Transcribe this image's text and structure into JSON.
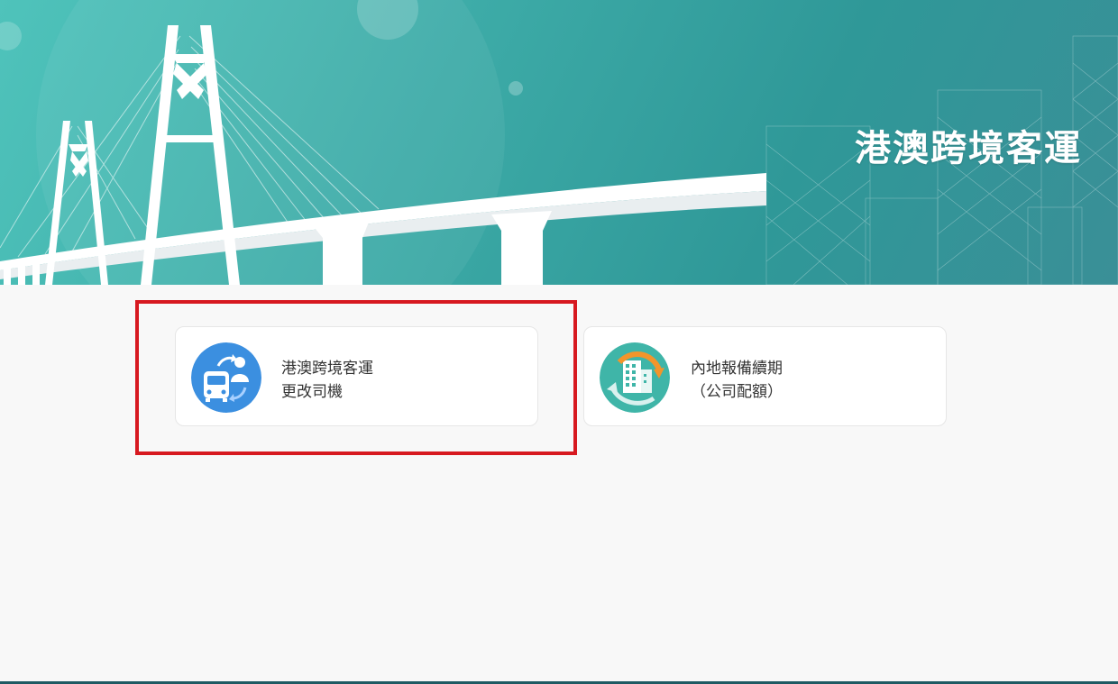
{
  "banner": {
    "title": "港澳跨境客運"
  },
  "services": [
    {
      "line1": "港澳跨境客運",
      "line2": "更改司機",
      "icon": "bus-driver-swap-icon",
      "icon_color": "#3b8fe0"
    },
    {
      "line1": "內地報備續期",
      "line2": "（公司配額）",
      "icon": "building-renewal-icon",
      "icon_color": "#3fb5a8"
    }
  ],
  "colors": {
    "banner": "#3aa7a4",
    "highlight": "#d71920",
    "card_border": "#e6e6e6",
    "background": "#f8f8f8"
  }
}
